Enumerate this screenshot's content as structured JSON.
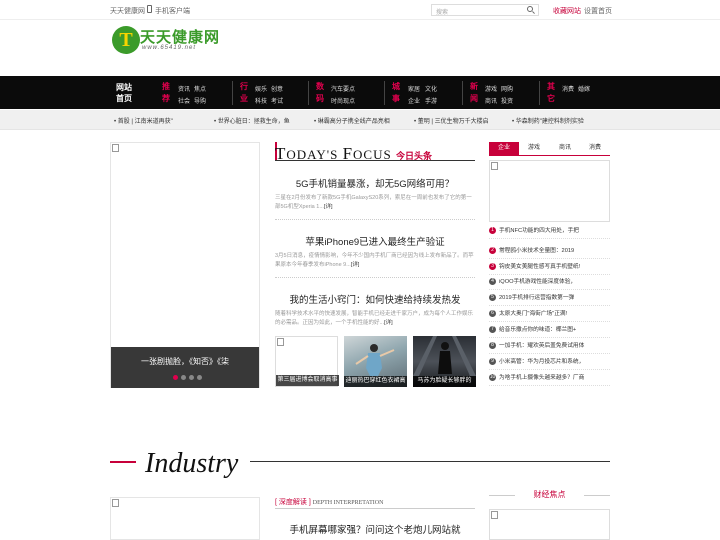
{
  "topbar": {
    "site_name": "天天健康网",
    "mobile": "手机客户端",
    "search_placeholder": "搜索",
    "favorite": "收藏网站",
    "homepage": "设置首页"
  },
  "logo": {
    "mark": "T",
    "name": "天天健康网",
    "url": "www.65419.net"
  },
  "nav": {
    "home": "网站首页",
    "groups": [
      {
        "category": "推荐",
        "items": [
          "资讯",
          "焦点",
          "社会",
          "导购"
        ]
      },
      {
        "category": "行业",
        "items": [
          "娱乐",
          "创意",
          "科技",
          "考试"
        ]
      },
      {
        "category": "数码",
        "items": [
          "汽车要点",
          "时尚现点"
        ]
      },
      {
        "category": "城事",
        "items": [
          "家居",
          "文化",
          "企业",
          "手游"
        ]
      },
      {
        "category": "新闻",
        "items": [
          "游戏",
          "网购",
          "商讯",
          "投资"
        ]
      },
      {
        "category": "其它",
        "items": [
          "消费",
          "婚嫁"
        ]
      }
    ]
  },
  "ticker": [
    "• 首股 | 江南米道再获\"",
    "• 世界心脏日：拯救生命，鱼",
    "• 琳霸高分子携全线产品亮相",
    "• 董明 | 三优生物万千大楼启",
    "• 华森制药\"建控料制剂实验"
  ],
  "hero": {
    "caption": "一张剧抛脸，《知否》《柒"
  },
  "focus": {
    "title_big1": "T",
    "title_small1": "ODAY'S ",
    "title_big2": "F",
    "title_small2": "OCUS",
    "title_cn": "今日头条"
  },
  "articles": [
    {
      "title": "5G手机销量暴涨，却无5G网络可用？",
      "summary": "三星在2月份发布了新款5G手机GalaxyS20系列，索尼在一周前也发布了它的第一部5G机型Xperia 1...",
      "more": "[详]"
    },
    {
      "title": "苹果iPhone9已进入最终生产验证",
      "summary": "3月5日消息，疫情情影响，今年不少国内手机厂商已经因为线上发布新品了。而苹果原本今年春季发布iPhone 9...",
      "more": "[详]"
    },
    {
      "title": "我的生活小窍门：如何快速给持续发热发",
      "summary": "随着科学技术水平的快速发展，智能手机已经走进千家万户，成为每个人工作娱乐的必需品。正因为如此，一个手机性能的好...",
      "more": "[详]"
    }
  ],
  "thumbs": [
    {
      "label": "第三届进博会取消高事"
    },
    {
      "label": "迪丽热巴穿红色衣裙高"
    },
    {
      "label": "马苏为脸疑长够胖的"
    }
  ],
  "right_tabs": [
    "企业",
    "游戏",
    "商讯",
    "消费"
  ],
  "right_list": [
    {
      "num": "1",
      "text": "手机NFC功能的四大用处，手把"
    },
    {
      "num": "2",
      "text": "常程鸥小米技术全量图：2019"
    },
    {
      "num": "3",
      "text": "钩皮美女美腿性感写真手机壁纸!"
    },
    {
      "num": "4",
      "text": "iQOO手机游戏性能深度体验，"
    },
    {
      "num": "5",
      "text": "2019手机排行运营指数第一弹"
    },
    {
      "num": "6",
      "text": "太原大奥门\"海街广场\"正满!"
    },
    {
      "num": "7",
      "text": "给音乐撒点你的味道：椰兰图+"
    },
    {
      "num": "8",
      "text": "一加手机：耀欢英后盖免费试用体"
    },
    {
      "num": "9",
      "text": "小米高管：华为月投芯片和系统，"
    },
    {
      "num": "10",
      "text": "为啥手机上摄像头越来越多？厂商"
    }
  ],
  "industry": {
    "title": "Industry",
    "interp_cn": "深度解读",
    "interp_en": "DEPTH INTERPRETATION",
    "headline": "手机屏幕哪家强？问问这个老炮儿网站就",
    "finance": "财经焦点"
  }
}
